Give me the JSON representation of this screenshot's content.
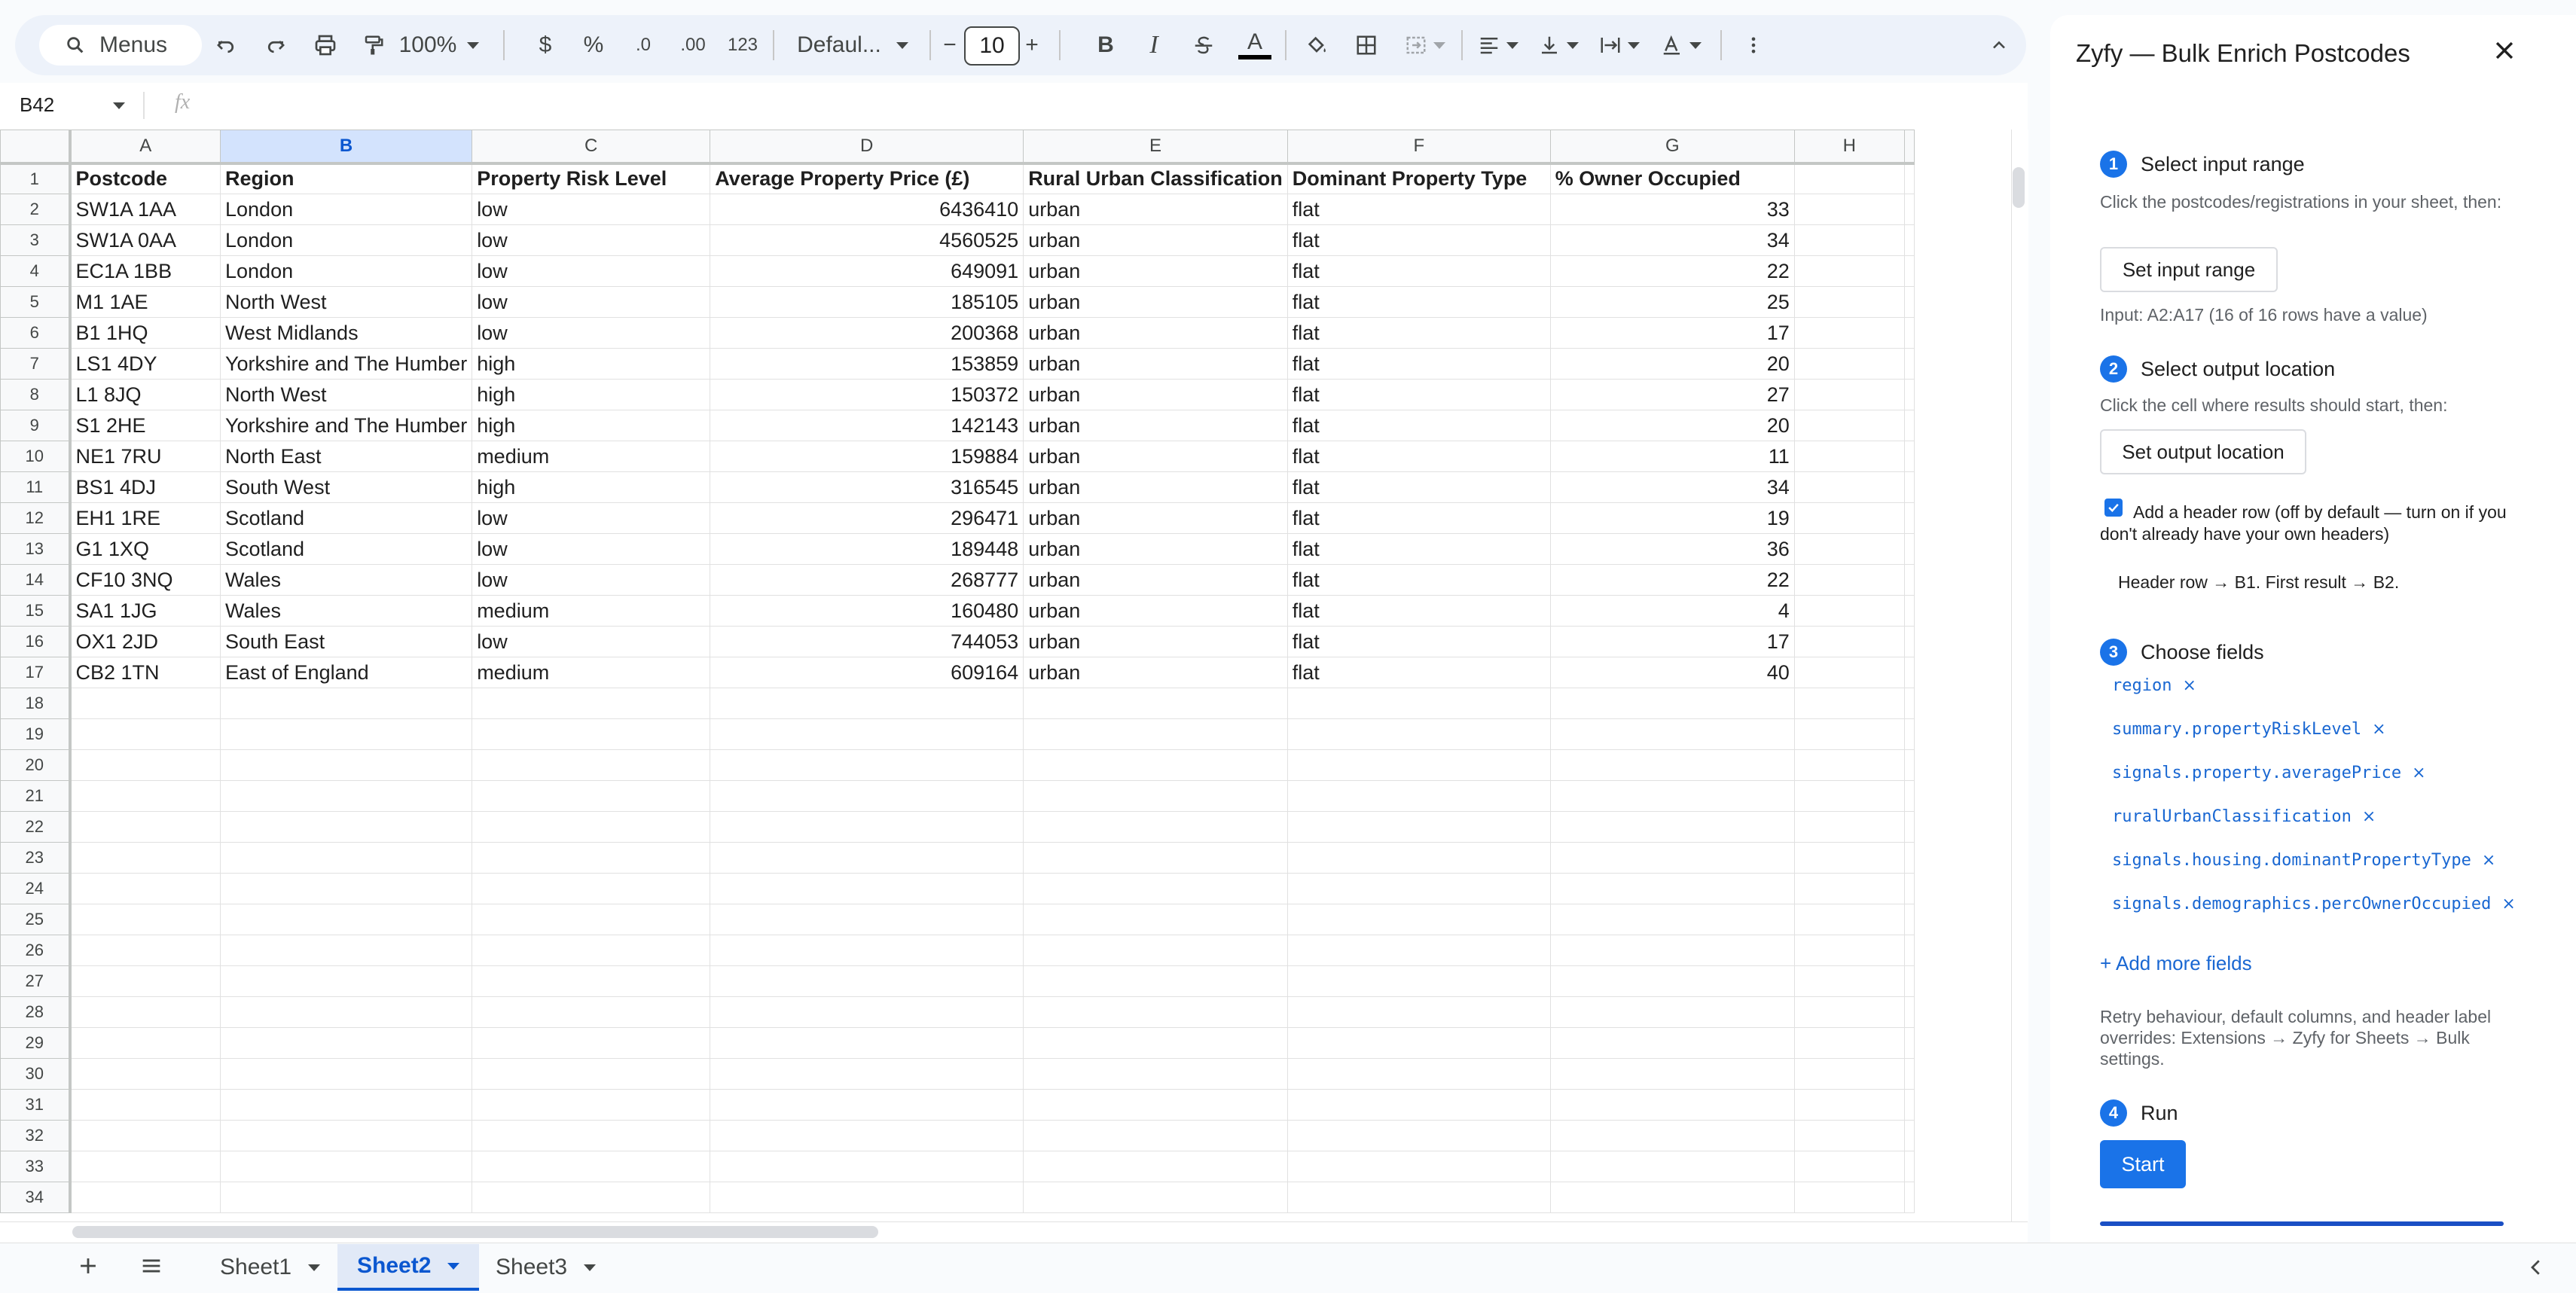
{
  "toolbar": {
    "menus_label": "Menus",
    "zoom": "100%",
    "currency": "$",
    "percent": "%",
    "dec_decrease": ".0",
    "dec_increase": ".00",
    "number_format": "123",
    "font": "Defaul...",
    "font_size": "10",
    "minus": "−",
    "plus": "+",
    "bold": "B",
    "italic": "I",
    "text_color_glyph": "A"
  },
  "formula_bar": {
    "cell_ref": "B42",
    "fx": "fx",
    "value": ""
  },
  "grid": {
    "columns": [
      "A",
      "B",
      "C",
      "D",
      "E",
      "F",
      "G",
      "H"
    ],
    "selected_column": "B",
    "header_row": [
      "Postcode",
      "Region",
      "Property Risk Level",
      "Average Property Price (£)",
      "Rural Urban Classification",
      "Dominant Property Type",
      "% Owner Occupied",
      ""
    ],
    "rows": [
      [
        "SW1A 1AA",
        "London",
        "low",
        "6436410",
        "urban",
        "flat",
        "33"
      ],
      [
        "SW1A 0AA",
        "London",
        "low",
        "4560525",
        "urban",
        "flat",
        "34"
      ],
      [
        "EC1A 1BB",
        "London",
        "low",
        "649091",
        "urban",
        "flat",
        "22"
      ],
      [
        "M1 1AE",
        "North West",
        "low",
        "185105",
        "urban",
        "flat",
        "25"
      ],
      [
        "B1 1HQ",
        "West Midlands",
        "low",
        "200368",
        "urban",
        "flat",
        "17"
      ],
      [
        "LS1 4DY",
        "Yorkshire and The Humber",
        "high",
        "153859",
        "urban",
        "flat",
        "20"
      ],
      [
        "L1 8JQ",
        "North West",
        "high",
        "150372",
        "urban",
        "flat",
        "27"
      ],
      [
        "S1 2HE",
        "Yorkshire and The Humber",
        "high",
        "142143",
        "urban",
        "flat",
        "20"
      ],
      [
        "NE1 7RU",
        "North East",
        "medium",
        "159884",
        "urban",
        "flat",
        "11"
      ],
      [
        "BS1 4DJ",
        "South West",
        "high",
        "316545",
        "urban",
        "flat",
        "34"
      ],
      [
        "EH1 1RE",
        "Scotland",
        "low",
        "296471",
        "urban",
        "flat",
        "19"
      ],
      [
        "G1 1XQ",
        "Scotland",
        "low",
        "189448",
        "urban",
        "flat",
        "36"
      ],
      [
        "CF10 3NQ",
        "Wales",
        "low",
        "268777",
        "urban",
        "flat",
        "22"
      ],
      [
        "SA1 1JG",
        "Wales",
        "medium",
        "160480",
        "urban",
        "flat",
        "4"
      ],
      [
        "OX1 2JD",
        "South East",
        "low",
        "744053",
        "urban",
        "flat",
        "17"
      ],
      [
        "CB2 1TN",
        "East of England",
        "medium",
        "609164",
        "urban",
        "flat",
        "40"
      ]
    ],
    "row_numbers": [
      "1",
      "2",
      "3",
      "4",
      "5",
      "6",
      "7",
      "8",
      "9",
      "10",
      "11",
      "12",
      "13",
      "14",
      "15",
      "16",
      "17",
      "18",
      "19",
      "20",
      "21",
      "22",
      "23",
      "24",
      "25",
      "26",
      "27",
      "28",
      "29",
      "30",
      "31",
      "32",
      "33",
      "34"
    ]
  },
  "sheet_tabs": [
    {
      "label": "Sheet1",
      "active": false
    },
    {
      "label": "Sheet2",
      "active": true
    },
    {
      "label": "Sheet3",
      "active": false
    }
  ],
  "panel": {
    "title": "Zyfy — Bulk Enrich Postcodes",
    "step1": {
      "num": "1",
      "title": "Select input range",
      "help": "Click the postcodes/registrations in your sheet, then:",
      "button": "Set input range",
      "status": "Input: A2:A17 (16 of 16 rows have a value)"
    },
    "step2": {
      "num": "2",
      "title": "Select output location",
      "help": "Click the cell where results should start, then:",
      "button": "Set output location"
    },
    "header_checkbox": {
      "checked": true,
      "label": "Add a header row (off by default — turn on if you don't already have your own headers)"
    },
    "mapping": "Header row → B1. First result → B2.",
    "step3": {
      "num": "3",
      "title": "Choose fields",
      "fields": [
        "region",
        "summary.propertyRiskLevel",
        "signals.property.averagePrice",
        "ruralUrbanClassification",
        "signals.housing.dominantPropertyType",
        "signals.demographics.percOwnerOccupied"
      ],
      "remove_glyph": "×",
      "add_more": "+ Add more fields"
    },
    "settings_note": "Retry behaviour, default columns, and header label overrides: Extensions → Zyfy for Sheets → Bulk settings.",
    "step4": {
      "num": "4",
      "title": "Run",
      "button": "Start"
    }
  },
  "colors": {
    "accent": "#1a73e8",
    "selected_header": "#d3e3fd",
    "link": "#1967d2"
  }
}
